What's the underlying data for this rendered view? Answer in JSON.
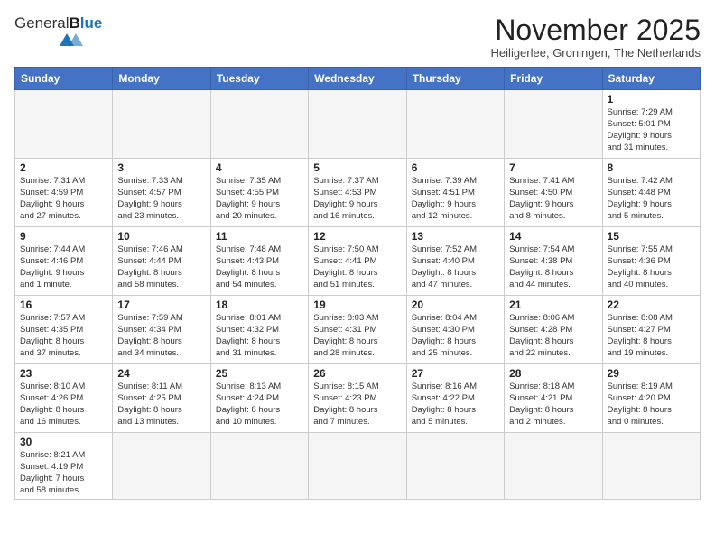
{
  "header": {
    "logo_general": "General",
    "logo_blue": "Blue",
    "month_title": "November 2025",
    "subtitle": "Heiligerlee, Groningen, The Netherlands"
  },
  "weekdays": [
    "Sunday",
    "Monday",
    "Tuesday",
    "Wednesday",
    "Thursday",
    "Friday",
    "Saturday"
  ],
  "weeks": [
    [
      {
        "day": "",
        "info": ""
      },
      {
        "day": "",
        "info": ""
      },
      {
        "day": "",
        "info": ""
      },
      {
        "day": "",
        "info": ""
      },
      {
        "day": "",
        "info": ""
      },
      {
        "day": "",
        "info": ""
      },
      {
        "day": "1",
        "info": "Sunrise: 7:29 AM\nSunset: 5:01 PM\nDaylight: 9 hours\nand 31 minutes."
      }
    ],
    [
      {
        "day": "2",
        "info": "Sunrise: 7:31 AM\nSunset: 4:59 PM\nDaylight: 9 hours\nand 27 minutes."
      },
      {
        "day": "3",
        "info": "Sunrise: 7:33 AM\nSunset: 4:57 PM\nDaylight: 9 hours\nand 23 minutes."
      },
      {
        "day": "4",
        "info": "Sunrise: 7:35 AM\nSunset: 4:55 PM\nDaylight: 9 hours\nand 20 minutes."
      },
      {
        "day": "5",
        "info": "Sunrise: 7:37 AM\nSunset: 4:53 PM\nDaylight: 9 hours\nand 16 minutes."
      },
      {
        "day": "6",
        "info": "Sunrise: 7:39 AM\nSunset: 4:51 PM\nDaylight: 9 hours\nand 12 minutes."
      },
      {
        "day": "7",
        "info": "Sunrise: 7:41 AM\nSunset: 4:50 PM\nDaylight: 9 hours\nand 8 minutes."
      },
      {
        "day": "8",
        "info": "Sunrise: 7:42 AM\nSunset: 4:48 PM\nDaylight: 9 hours\nand 5 minutes."
      }
    ],
    [
      {
        "day": "9",
        "info": "Sunrise: 7:44 AM\nSunset: 4:46 PM\nDaylight: 9 hours\nand 1 minute."
      },
      {
        "day": "10",
        "info": "Sunrise: 7:46 AM\nSunset: 4:44 PM\nDaylight: 8 hours\nand 58 minutes."
      },
      {
        "day": "11",
        "info": "Sunrise: 7:48 AM\nSunset: 4:43 PM\nDaylight: 8 hours\nand 54 minutes."
      },
      {
        "day": "12",
        "info": "Sunrise: 7:50 AM\nSunset: 4:41 PM\nDaylight: 8 hours\nand 51 minutes."
      },
      {
        "day": "13",
        "info": "Sunrise: 7:52 AM\nSunset: 4:40 PM\nDaylight: 8 hours\nand 47 minutes."
      },
      {
        "day": "14",
        "info": "Sunrise: 7:54 AM\nSunset: 4:38 PM\nDaylight: 8 hours\nand 44 minutes."
      },
      {
        "day": "15",
        "info": "Sunrise: 7:55 AM\nSunset: 4:36 PM\nDaylight: 8 hours\nand 40 minutes."
      }
    ],
    [
      {
        "day": "16",
        "info": "Sunrise: 7:57 AM\nSunset: 4:35 PM\nDaylight: 8 hours\nand 37 minutes."
      },
      {
        "day": "17",
        "info": "Sunrise: 7:59 AM\nSunset: 4:34 PM\nDaylight: 8 hours\nand 34 minutes."
      },
      {
        "day": "18",
        "info": "Sunrise: 8:01 AM\nSunset: 4:32 PM\nDaylight: 8 hours\nand 31 minutes."
      },
      {
        "day": "19",
        "info": "Sunrise: 8:03 AM\nSunset: 4:31 PM\nDaylight: 8 hours\nand 28 minutes."
      },
      {
        "day": "20",
        "info": "Sunrise: 8:04 AM\nSunset: 4:30 PM\nDaylight: 8 hours\nand 25 minutes."
      },
      {
        "day": "21",
        "info": "Sunrise: 8:06 AM\nSunset: 4:28 PM\nDaylight: 8 hours\nand 22 minutes."
      },
      {
        "day": "22",
        "info": "Sunrise: 8:08 AM\nSunset: 4:27 PM\nDaylight: 8 hours\nand 19 minutes."
      }
    ],
    [
      {
        "day": "23",
        "info": "Sunrise: 8:10 AM\nSunset: 4:26 PM\nDaylight: 8 hours\nand 16 minutes."
      },
      {
        "day": "24",
        "info": "Sunrise: 8:11 AM\nSunset: 4:25 PM\nDaylight: 8 hours\nand 13 minutes."
      },
      {
        "day": "25",
        "info": "Sunrise: 8:13 AM\nSunset: 4:24 PM\nDaylight: 8 hours\nand 10 minutes."
      },
      {
        "day": "26",
        "info": "Sunrise: 8:15 AM\nSunset: 4:23 PM\nDaylight: 8 hours\nand 7 minutes."
      },
      {
        "day": "27",
        "info": "Sunrise: 8:16 AM\nSunset: 4:22 PM\nDaylight: 8 hours\nand 5 minutes."
      },
      {
        "day": "28",
        "info": "Sunrise: 8:18 AM\nSunset: 4:21 PM\nDaylight: 8 hours\nand 2 minutes."
      },
      {
        "day": "29",
        "info": "Sunrise: 8:19 AM\nSunset: 4:20 PM\nDaylight: 8 hours\nand 0 minutes."
      }
    ],
    [
      {
        "day": "30",
        "info": "Sunrise: 8:21 AM\nSunset: 4:19 PM\nDaylight: 7 hours\nand 58 minutes."
      },
      {
        "day": "",
        "info": ""
      },
      {
        "day": "",
        "info": ""
      },
      {
        "day": "",
        "info": ""
      },
      {
        "day": "",
        "info": ""
      },
      {
        "day": "",
        "info": ""
      },
      {
        "day": "",
        "info": ""
      }
    ]
  ]
}
